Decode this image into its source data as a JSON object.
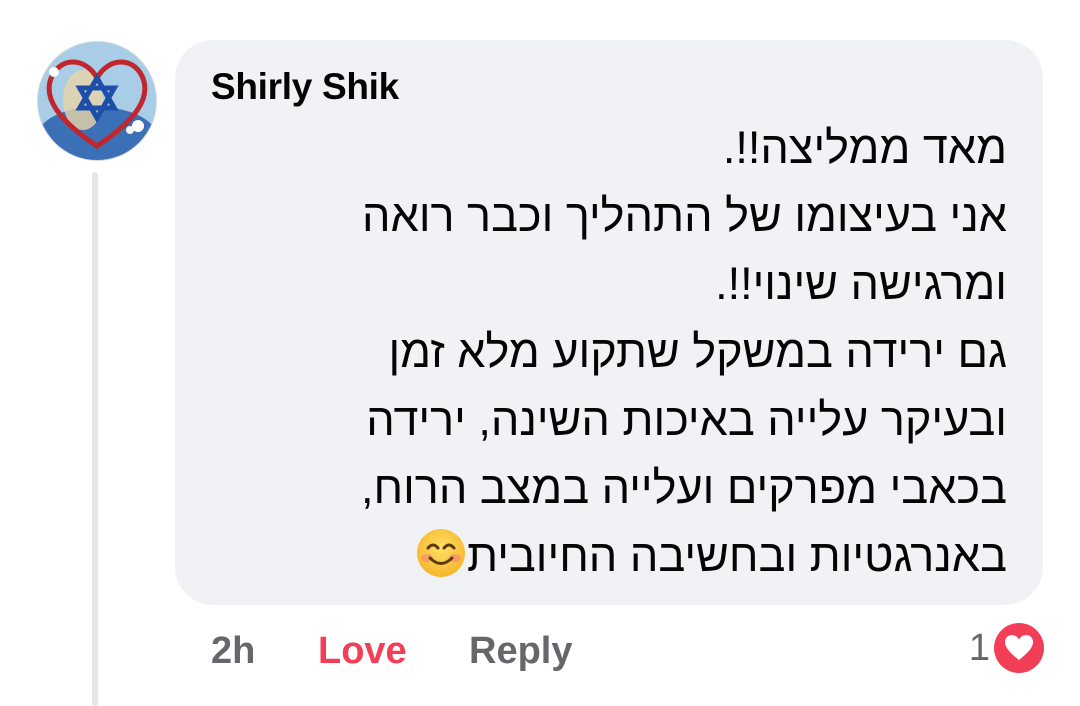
{
  "comment": {
    "author": "Shirly Shik",
    "avatar_icon": "profile-photo-star-of-david-heart",
    "body_lines": [
      "מאד ממליצה!!.",
      "אני בעיצומו של התהליך וכבר רואה",
      "ומרגישה שינוי!!.",
      "גם ירידה במשקל שתקוע מלא זמן",
      "ובעיקר עלייה באיכות השינה, ירידה",
      "בכאבי מפרקים ועלייה  במצב הרוח,",
      "באנרגטיות ובחשיבה החיובית"
    ],
    "trailing_emoji": "smiling-face-emoji"
  },
  "actions": {
    "time": "2h",
    "love_label": "Love",
    "reply_label": "Reply"
  },
  "reactions": {
    "count": "1",
    "type_icon": "heart-reaction-icon"
  },
  "colors": {
    "bubble_bg": "#f0f2f5",
    "love_red": "#f33e58",
    "meta_gray": "#65676b",
    "text": "#050505"
  }
}
